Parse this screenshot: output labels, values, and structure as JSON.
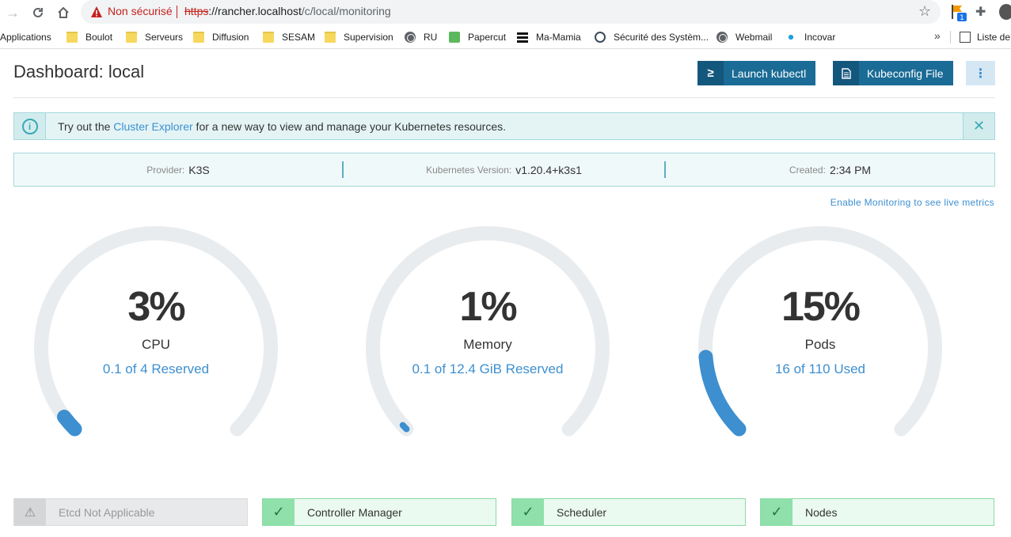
{
  "browser": {
    "insecure_label": "Non sécurisé",
    "url_scheme": "https",
    "url_rest": "://rancher.localhost",
    "url_path": "/c/local/monitoring",
    "ext_badge": "1"
  },
  "bookmarks": [
    {
      "label": "Applications",
      "icon": "apps-grid-icon"
    },
    {
      "label": "Boulot",
      "icon": "folder-icon"
    },
    {
      "label": "Serveurs",
      "icon": "folder-icon"
    },
    {
      "label": "Diffusion",
      "icon": "folder-icon"
    },
    {
      "label": "SESAM",
      "icon": "folder-icon"
    },
    {
      "label": "Supervision",
      "icon": "folder-icon"
    },
    {
      "label": "RU",
      "icon": "globe-icon"
    },
    {
      "label": "Papercut",
      "icon": "papercut-icon"
    },
    {
      "label": "Ma-Mamia",
      "icon": "grid-icon"
    },
    {
      "label": "Sécurité des Systèm...",
      "icon": "security-icon"
    },
    {
      "label": "Webmail",
      "icon": "globe-icon"
    },
    {
      "label": "Incovar",
      "icon": "incovar-icon"
    }
  ],
  "bookmarks_more": "»",
  "reading_list": "Liste de",
  "header": {
    "title": "Dashboard: local",
    "launch_kubectl": "Launch kubectl",
    "kubeconfig_file": "Kubeconfig File",
    "kubectl_icon": "≥"
  },
  "banner": {
    "prefix": "Try out the ",
    "link": "Cluster Explorer",
    "suffix": " for a new way to view and manage your Kubernetes resources."
  },
  "info": {
    "provider_key": "Provider:",
    "provider_value": "K3S",
    "version_key": "Kubernetes Version:",
    "version_value": "v1.20.4+k3s1",
    "created_key": "Created:",
    "created_value": "2:34 PM"
  },
  "enable_monitoring": "Enable Monitoring to see live metrics",
  "gauges": [
    {
      "value": "3%",
      "fraction": 0.03,
      "label": "CPU",
      "sub": "0.1 of 4 Reserved"
    },
    {
      "value": "1%",
      "fraction": 0.01,
      "label": "Memory",
      "sub": "0.1 of 12.4 GiB Reserved"
    },
    {
      "value": "15%",
      "fraction": 0.15,
      "label": "Pods",
      "sub": "16 of 110 Used"
    }
  ],
  "status": [
    {
      "label": "Etcd Not Applicable",
      "state": "na"
    },
    {
      "label": "Controller Manager",
      "state": "ok"
    },
    {
      "label": "Scheduler",
      "state": "ok"
    },
    {
      "label": "Nodes",
      "state": "ok"
    }
  ],
  "colors": {
    "accent": "#3d8fd0",
    "track": "#e9ecee",
    "primary_button": "#1a6b96",
    "ok": "#8fe0aa"
  }
}
